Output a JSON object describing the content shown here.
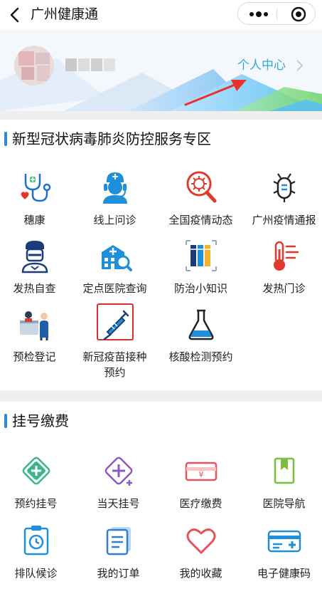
{
  "navbar": {
    "title": "广州健康通"
  },
  "banner": {
    "personal_center": "个人中心"
  },
  "colors": {
    "accent": "#2f87d6",
    "link": "#35a8d6",
    "arrow": "#e8322b"
  },
  "section1": {
    "title": "新型冠状病毒肺炎防控服务专区",
    "items": [
      {
        "label": "穗康",
        "icon": "stethoscope-icon"
      },
      {
        "label": "线上问诊",
        "icon": "doctor-headset-icon"
      },
      {
        "label": "全国疫情动态",
        "icon": "virus-magnifier-icon"
      },
      {
        "label": "广州疫情通报",
        "icon": "bug-icon"
      },
      {
        "label": "发热自查",
        "icon": "masked-person-icon"
      },
      {
        "label": "定点医院查询",
        "icon": "hospital-search-icon"
      },
      {
        "label": "防治小知识",
        "icon": "books-icon"
      },
      {
        "label": "发热门诊",
        "icon": "thermometer-icon"
      },
      {
        "label": "预检登记",
        "icon": "reception-desk-icon"
      },
      {
        "label": "新冠疫苗接种",
        "label2": "预约",
        "icon": "syringe-icon"
      },
      {
        "label": "核酸检测预约",
        "icon": "flask-icon"
      }
    ]
  },
  "section2": {
    "title": "挂号缴费",
    "items": [
      {
        "label": "预约挂号",
        "icon": "medical-cross-icon"
      },
      {
        "label": "当天挂号",
        "icon": "cross-add-icon"
      },
      {
        "label": "医疗缴费",
        "icon": "yuan-card-icon"
      },
      {
        "label": "医院导航",
        "icon": "bookmark-book-icon"
      },
      {
        "label": "排队候诊",
        "icon": "clock-board-icon"
      },
      {
        "label": "我的订单",
        "icon": "order-document-icon"
      },
      {
        "label": "我的收藏",
        "icon": "heart-icon"
      },
      {
        "label": "电子健康码",
        "icon": "health-card-icon"
      }
    ]
  }
}
